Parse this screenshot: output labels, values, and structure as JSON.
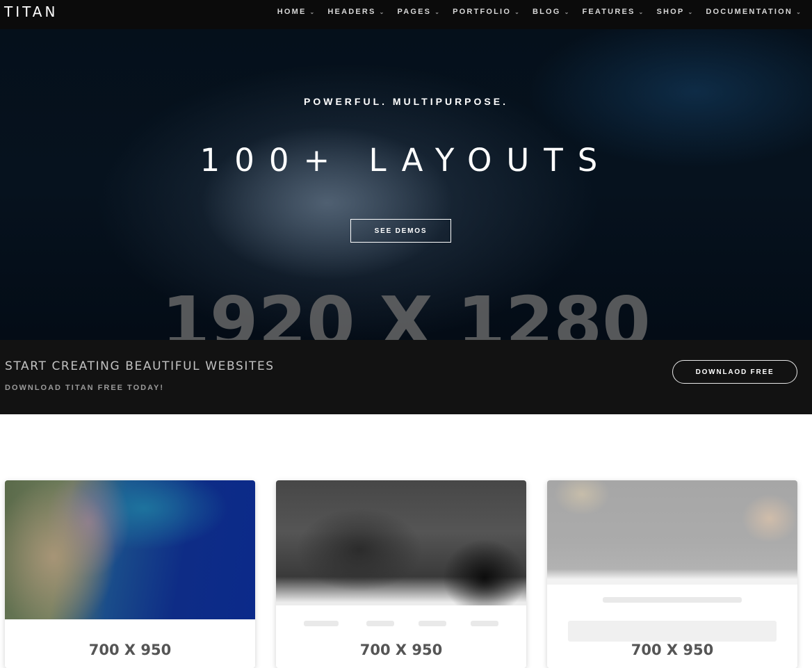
{
  "brand": "TITAN",
  "nav": [
    {
      "label": "HOME"
    },
    {
      "label": "HEADERS"
    },
    {
      "label": "PAGES"
    },
    {
      "label": "PORTFOLIO"
    },
    {
      "label": "BLOG"
    },
    {
      "label": "FEATURES"
    },
    {
      "label": "SHOP"
    },
    {
      "label": "DOCUMENTATION"
    }
  ],
  "icons": {
    "nav_dropdown": "chevron-down-icon"
  },
  "hero": {
    "subtitle": "POWERFUL. MULTIPURPOSE.",
    "title": "100+ LAYOUTS",
    "button": "SEE DEMOS",
    "placeholder_dims": "1920 X 1280"
  },
  "cta": {
    "title": "START CREATING BEAUTIFUL WEBSITES",
    "subtitle": "DOWNLOAD TITAN FREE TODAY!",
    "button": "DOWNLAOD FREE"
  },
  "cards": [
    {
      "dims": "700 X 950"
    },
    {
      "dims": "700 X 950"
    },
    {
      "dims": "700 X 950"
    }
  ]
}
